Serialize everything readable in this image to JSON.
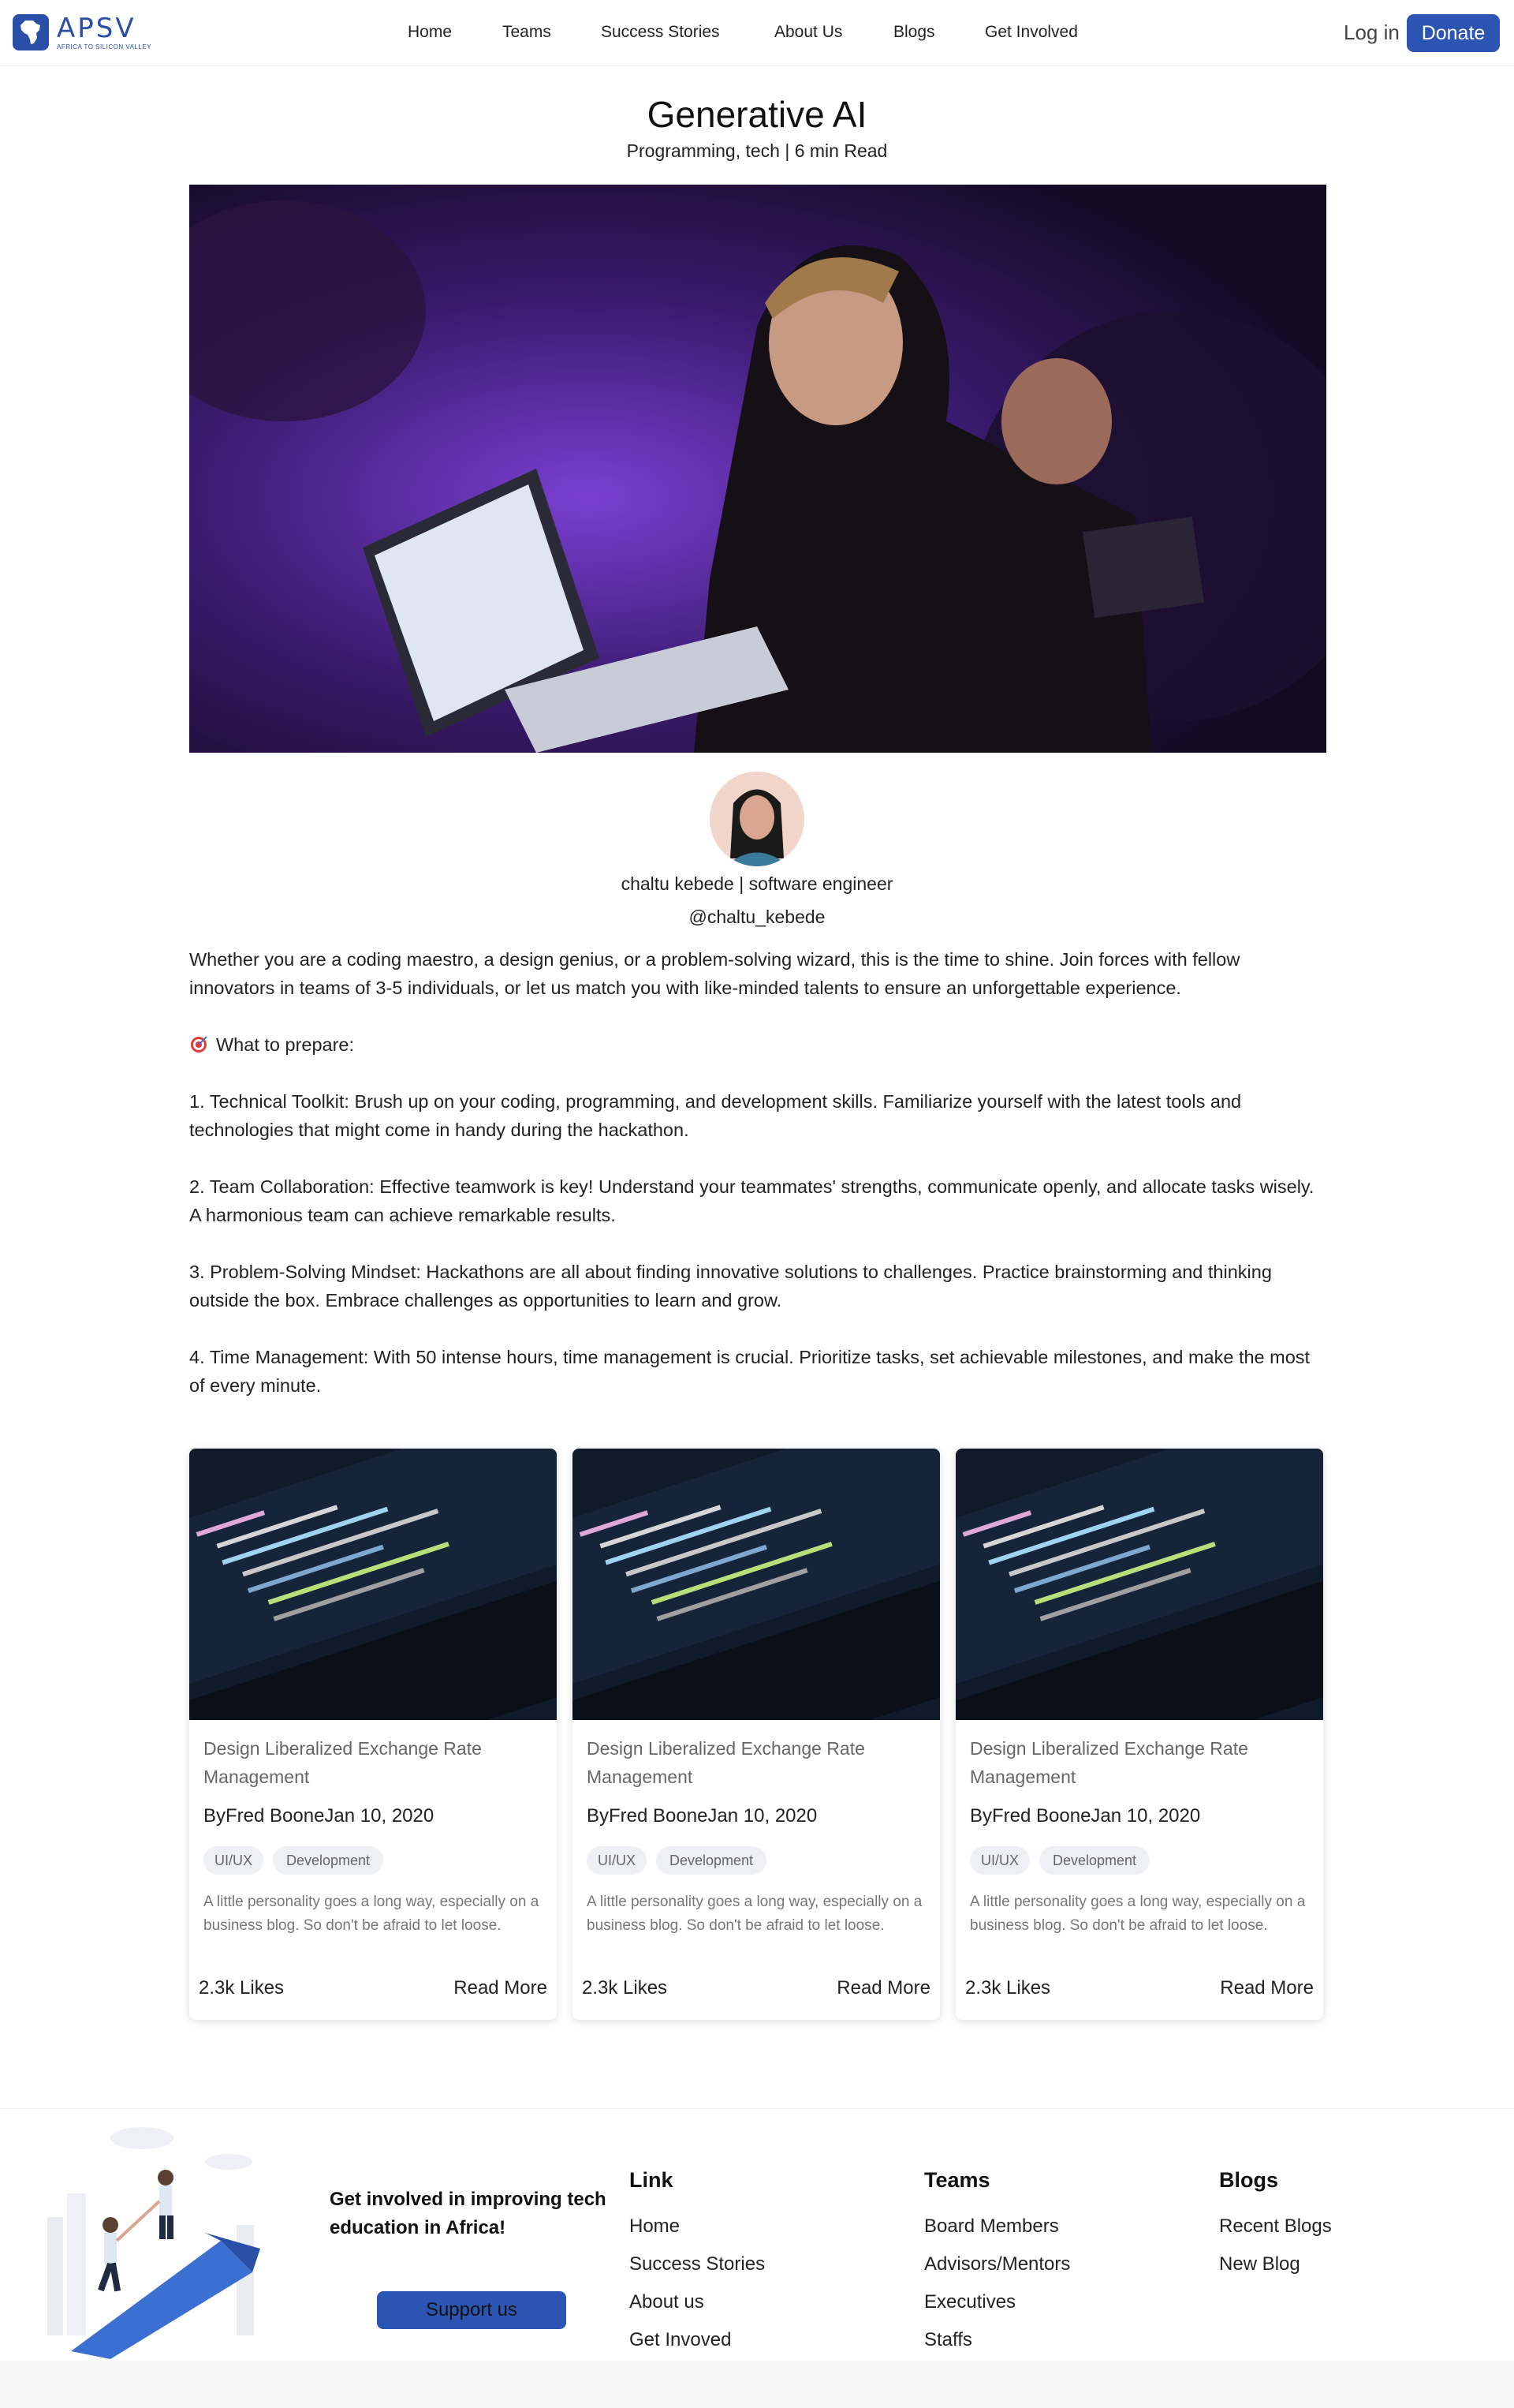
{
  "nav": {
    "logo_word": "APSV",
    "logo_tagline": "AFRICA TO SILICON VALLEY",
    "links": [
      "Home",
      "Teams",
      "Success Stories",
      "About Us",
      "Blogs",
      "Get Involved"
    ],
    "login": "Log in",
    "donate": "Donate"
  },
  "post": {
    "title": "Generative AI",
    "meta": "Programming, tech | 6 min Read",
    "author": "chaltu kebede | software engineer",
    "handle": "@chaltu_kebede",
    "paragraphs": [
      " Whether you are a coding maestro, a design genius, or a problem-solving wizard, this is the time to shine. Join forces with fellow innovators in teams of 3-5 individuals, or let us match you with like-minded talents to ensure an unforgettable experience.",
      "What to prepare:",
      "1. Technical Toolkit: Brush up on your coding, programming, and development skills. Familiarize yourself with the latest tools and technologies that might come in handy during the hackathon.",
      "2. Team Collaboration: Effective teamwork is key! Understand your teammates' strengths, communicate openly, and allocate tasks wisely. A harmonious team can achieve remarkable results.",
      "3. Problem-Solving Mindset: Hackathons are all about finding innovative solutions to challenges. Practice brainstorming and thinking outside the box. Embrace challenges as opportunities to learn and grow.",
      "4. Time Management: With 50 intense hours, time management is crucial. Prioritize tasks, set achievable milestones, and make the most of every minute."
    ]
  },
  "cards": [
    {
      "title": "Design Liberalized Exchange Rate Management",
      "byline": "ByFred BooneJan 10, 2020",
      "tags": [
        "UI/UX",
        "Development"
      ],
      "desc": "A little personality goes a long way, especially on a business blog. So don't be afraid to let loose.",
      "likes": "2.3k Likes",
      "read_more": "Read More"
    },
    {
      "title": "Design Liberalized Exchange Rate Management",
      "byline": "ByFred BooneJan 10, 2020",
      "tags": [
        "UI/UX",
        "Development"
      ],
      "desc": "A little personality goes a long way, especially on a business blog. So don't be afraid to let loose.",
      "likes": "2.3k Likes",
      "read_more": "Read More"
    },
    {
      "title": "Design Liberalized Exchange Rate Management",
      "byline": "ByFred BooneJan 10, 2020",
      "tags": [
        "UI/UX",
        "Development"
      ],
      "desc": "A little personality goes a long way, especially on a business blog. So don't be afraid to let loose.",
      "likes": "2.3k Likes",
      "read_more": "Read More"
    }
  ],
  "footer": {
    "cta": "Get involved in improving tech education in Africa!",
    "support": "Support us",
    "link_heading": "Link",
    "links": [
      "Home",
      "Success Stories",
      "About us",
      "Get Invoved"
    ],
    "teams_heading": "Teams",
    "teams": [
      "Board Members",
      "Advisors/Mentors",
      "Executives",
      "Staffs"
    ],
    "blogs_heading": "Blogs",
    "blogs": [
      "Recent Blogs",
      "New Blog"
    ]
  },
  "colors": {
    "brand": "#2c55b3",
    "text": "#222222",
    "muted": "#666666"
  },
  "icons": [
    "africa-logo-icon",
    "target-icon"
  ]
}
